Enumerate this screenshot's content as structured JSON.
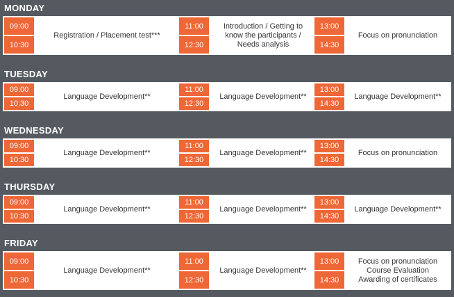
{
  "days": [
    {
      "name": "MONDAY",
      "sessions": [
        {
          "start": "09:00",
          "end": "10:30",
          "activity": "Registration / Placement test***"
        },
        {
          "start": "11:00",
          "end": "12:30",
          "activity": "Introduction / Getting to\nknow the participants /\nNeeds analysis"
        },
        {
          "start": "13:00",
          "end": "14:30",
          "activity": "Focus on pronunciation"
        }
      ]
    },
    {
      "name": "TUESDAY",
      "sessions": [
        {
          "start": "09:00",
          "end": "10:30",
          "activity": "Language Development**"
        },
        {
          "start": "11:00",
          "end": "12:30",
          "activity": "Language Development**"
        },
        {
          "start": "13:00",
          "end": "14:30",
          "activity": "Language Development**"
        }
      ]
    },
    {
      "name": "WEDNESDAY",
      "sessions": [
        {
          "start": "09:00",
          "end": "10:30",
          "activity": "Language Development**"
        },
        {
          "start": "11:00",
          "end": "12:30",
          "activity": "Language Development**"
        },
        {
          "start": "13:00",
          "end": "14:30",
          "activity": "Focus on pronunciation"
        }
      ]
    },
    {
      "name": "THURSDAY",
      "sessions": [
        {
          "start": "09:00",
          "end": "10:30",
          "activity": "Language Development**"
        },
        {
          "start": "11:00",
          "end": "12:30",
          "activity": "Language Development**"
        },
        {
          "start": "13:00",
          "end": "14:30",
          "activity": "Language Development**"
        }
      ]
    },
    {
      "name": "FRIDAY",
      "sessions": [
        {
          "start": "09:00",
          "end": "10:30",
          "activity": "Language Development**"
        },
        {
          "start": "11:00",
          "end": "12:30",
          "activity": "Language Development**"
        },
        {
          "start": "13:00",
          "end": "14:30",
          "activity": "Focus on pronunciation\nCourse Evaluation\nAwarding of certificates"
        }
      ]
    }
  ],
  "colors": {
    "background": "#555a61",
    "time_cell": "#ee6737",
    "row": "#ffffff"
  }
}
